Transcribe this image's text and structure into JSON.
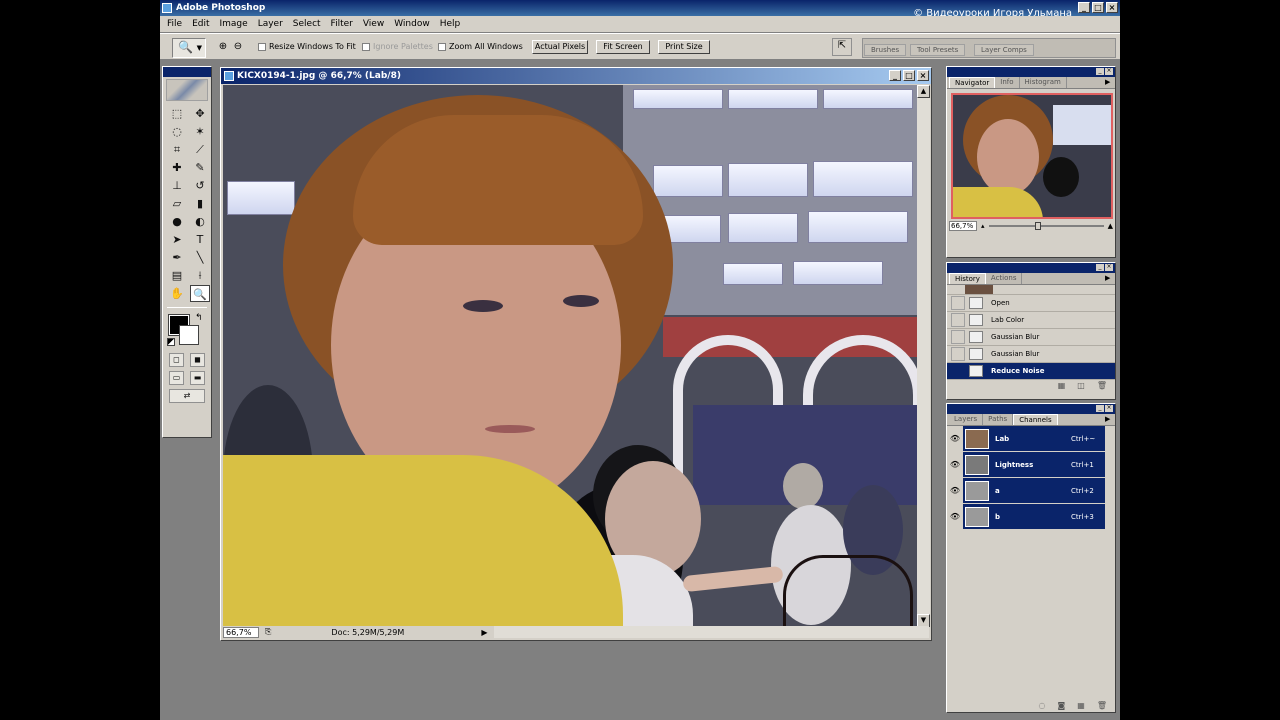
{
  "app": {
    "title": "Adobe Photoshop",
    "watermark": "© Видеоуроки Игоря Ульмана"
  },
  "menu": [
    "File",
    "Edit",
    "Image",
    "Layer",
    "Select",
    "Filter",
    "View",
    "Window",
    "Help"
  ],
  "options": {
    "resize_windows": "Resize Windows To Fit",
    "ignore_palettes": "Ignore Palettes",
    "zoom_all": "Zoom All Windows",
    "actual_pixels": "Actual Pixels",
    "fit_screen": "Fit Screen",
    "print_size": "Print Size",
    "well_tabs": [
      "Brushes",
      "Tool Presets",
      "Layer Comps"
    ]
  },
  "document": {
    "title": "KICX0194-1.jpg @ 66,7% (Lab/8)",
    "zoom": "66,7%",
    "doc_size": "Doc: 5,29M/5,29M"
  },
  "navigator": {
    "tabs": [
      "Navigator",
      "Info",
      "Histogram"
    ],
    "zoom": "66,7%"
  },
  "history": {
    "tabs": [
      "History",
      "Actions"
    ],
    "items": [
      "Open",
      "Lab Color",
      "Gaussian Blur",
      "Gaussian Blur",
      "Reduce Noise"
    ],
    "selected": "Reduce Noise"
  },
  "channels": {
    "tabs": [
      "Layers",
      "Paths",
      "Channels"
    ],
    "items": [
      {
        "name": "Lab",
        "shortcut": "Ctrl+~"
      },
      {
        "name": "Lightness",
        "shortcut": "Ctrl+1"
      },
      {
        "name": "a",
        "shortcut": "Ctrl+2"
      },
      {
        "name": "b",
        "shortcut": "Ctrl+3"
      }
    ]
  },
  "colors": {
    "selection": "#0a246a",
    "panel": "#d4d0c8",
    "workspace": "#808080"
  }
}
